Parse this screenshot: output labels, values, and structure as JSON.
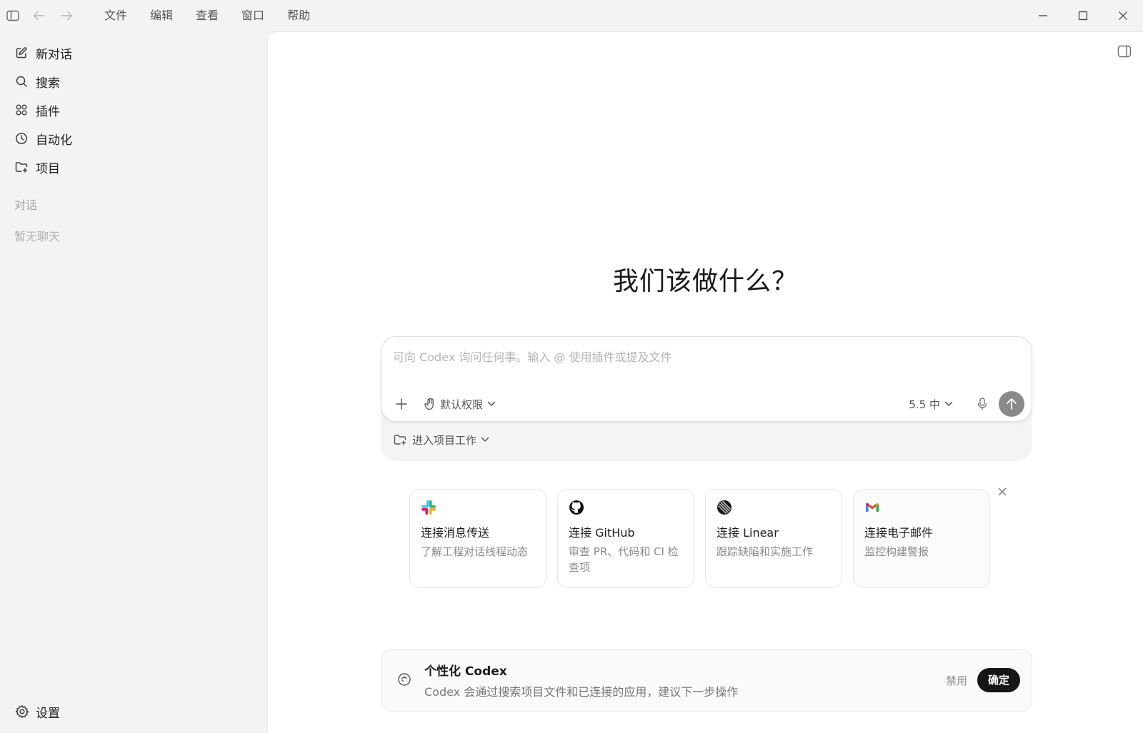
{
  "titlebar": {
    "menu": [
      "文件",
      "编辑",
      "查看",
      "窗口",
      "帮助"
    ]
  },
  "sidebar": {
    "items": [
      {
        "label": "新对话",
        "icon": "edit-icon"
      },
      {
        "label": "搜索",
        "icon": "search-icon"
      },
      {
        "label": "插件",
        "icon": "grid-icon"
      },
      {
        "label": "自动化",
        "icon": "clock-icon"
      },
      {
        "label": "项目",
        "icon": "folder-plus-icon"
      }
    ],
    "section_label": "对话",
    "empty_label": "暂无聊天",
    "settings_label": "设置"
  },
  "main": {
    "headline": "我们该做什么？",
    "composer": {
      "placeholder": "可向 Codex 询问任何事。输入 @ 使用插件或提及文件",
      "permission_label": "默认权限",
      "model_label": "5.5 中",
      "project_label": "进入项目工作"
    },
    "cards": [
      {
        "title": "连接消息传送",
        "desc": "了解工程对话线程动态",
        "logo": "slack-icon"
      },
      {
        "title": "连接 GitHub",
        "desc": "审查 PR、代码和 CI 检查项",
        "logo": "github-icon"
      },
      {
        "title": "连接 Linear",
        "desc": "跟踪缺陷和实施工作",
        "logo": "linear-icon"
      },
      {
        "title": "连接电子邮件",
        "desc": "监控构建警报",
        "logo": "gmail-icon"
      }
    ],
    "banner": {
      "title": "个性化 Codex",
      "desc": "Codex 会通过搜索项目文件和已连接的应用，建议下一步操作",
      "disable_label": "禁用",
      "confirm_label": "确定"
    }
  },
  "colors": {
    "sidebar_bg": "#f3f3f4",
    "main_bg": "#ffffff",
    "send_button": "#8a8a8a",
    "confirm_button": "#161616"
  }
}
